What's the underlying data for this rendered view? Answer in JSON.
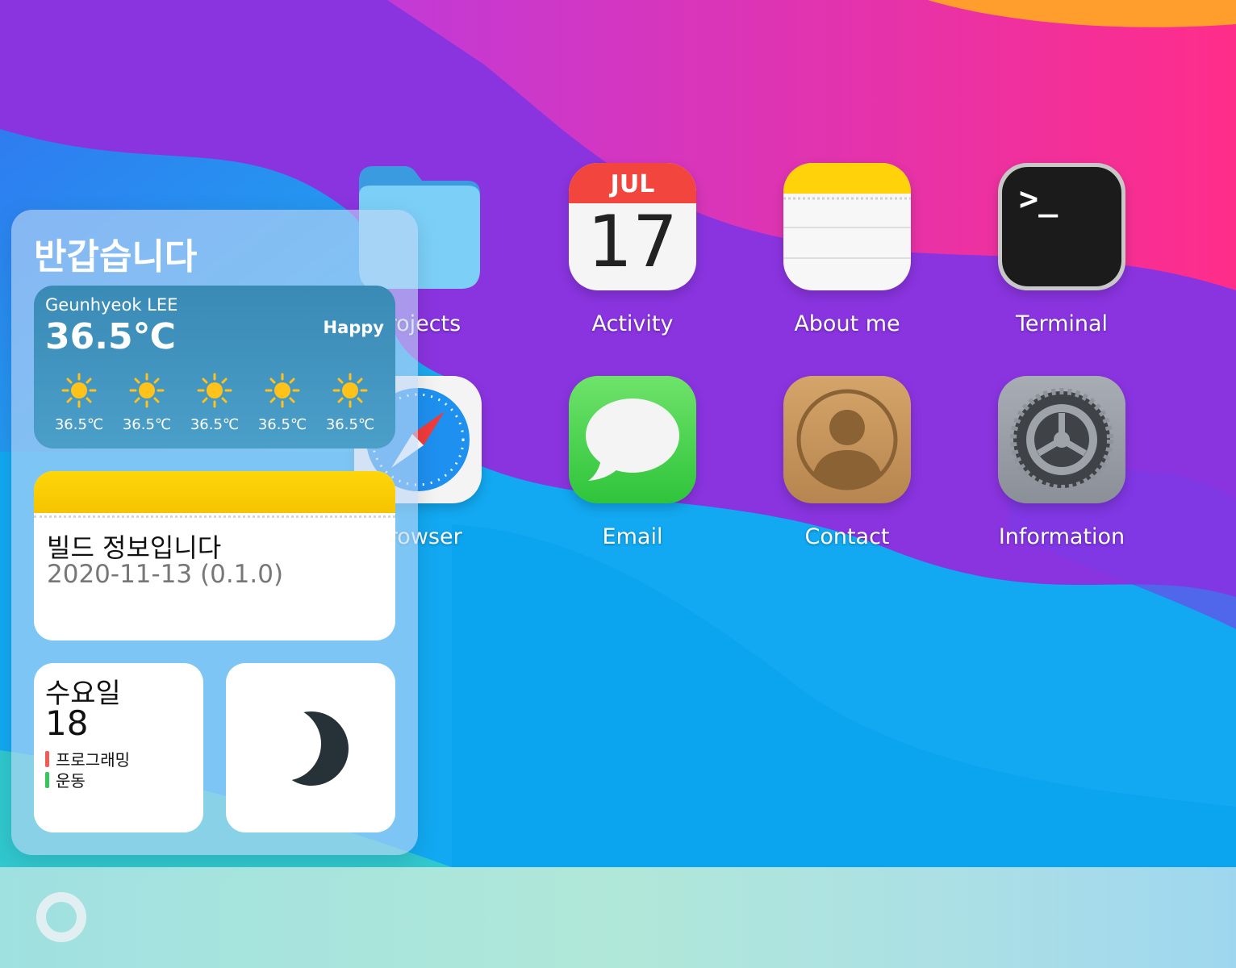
{
  "desktop": {
    "apps": [
      {
        "id": "projects",
        "label": "Projects",
        "icon": "folder-icon"
      },
      {
        "id": "activity",
        "label": "Activity",
        "icon": "calendar-icon",
        "month": "JUL",
        "day": "17"
      },
      {
        "id": "about",
        "label": "About me",
        "icon": "notes-icon"
      },
      {
        "id": "terminal",
        "label": "Terminal",
        "icon": "terminal-icon",
        "prompt": ">_"
      },
      {
        "id": "browser",
        "label": "Browser",
        "icon": "compass-icon"
      },
      {
        "id": "email",
        "label": "Email",
        "icon": "speech-bubble-icon"
      },
      {
        "id": "contact",
        "label": "Contact",
        "icon": "person-icon"
      },
      {
        "id": "information",
        "label": "Information",
        "icon": "gear-icon"
      }
    ]
  },
  "widgets": {
    "greeting": "반갑습니다",
    "weather": {
      "name": "Geunhyeok LEE",
      "temp": "36.5℃",
      "mood": "Happy",
      "forecast": [
        "36.5℃",
        "36.5℃",
        "36.5℃",
        "36.5℃",
        "36.5℃"
      ],
      "icon": "sun-icon"
    },
    "notes": {
      "title": "빌드 정보입니다",
      "subtitle": "2020-11-13 (0.1.0)"
    },
    "calendar": {
      "weekday": "수요일",
      "day": "18",
      "events": [
        {
          "label": "프로그래밍",
          "color": "#f25c54"
        },
        {
          "label": "운동",
          "color": "#34c759"
        }
      ]
    },
    "moon": {
      "icon": "moon-icon",
      "color": "#263238"
    }
  },
  "dock": {
    "home_icon": "home-circle-icon"
  }
}
